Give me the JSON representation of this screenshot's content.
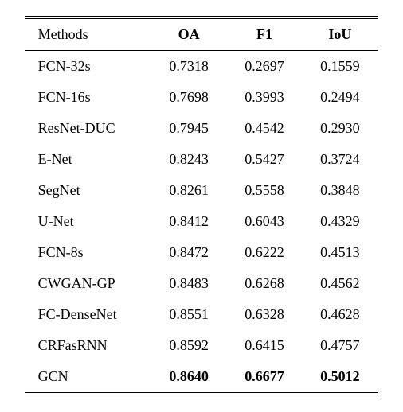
{
  "chart_data": {
    "type": "table",
    "title": "",
    "columns": [
      "Methods",
      "OA",
      "F1",
      "IoU"
    ],
    "rows": [
      {
        "method": "FCN-32s",
        "oa": "0.7318",
        "f1": "0.2697",
        "iou": "0.1559",
        "bold": false
      },
      {
        "method": "FCN-16s",
        "oa": "0.7698",
        "f1": "0.3993",
        "iou": "0.2494",
        "bold": false
      },
      {
        "method": "ResNet-DUC",
        "oa": "0.7945",
        "f1": "0.4542",
        "iou": "0.2930",
        "bold": false
      },
      {
        "method": "E-Net",
        "oa": "0.8243",
        "f1": "0.5427",
        "iou": "0.3724",
        "bold": false
      },
      {
        "method": "SegNet",
        "oa": "0.8261",
        "f1": "0.5558",
        "iou": "0.3848",
        "bold": false
      },
      {
        "method": "U-Net",
        "oa": "0.8412",
        "f1": "0.6043",
        "iou": "0.4329",
        "bold": false
      },
      {
        "method": "FCN-8s",
        "oa": "0.8472",
        "f1": "0.6222",
        "iou": "0.4513",
        "bold": false
      },
      {
        "method": "CWGAN-GP",
        "oa": "0.8483",
        "f1": "0.6268",
        "iou": "0.4562",
        "bold": false
      },
      {
        "method": "FC-DenseNet",
        "oa": "0.8551",
        "f1": "0.6328",
        "iou": "0.4628",
        "bold": false
      },
      {
        "method": "CRFasRNN",
        "oa": "0.8592",
        "f1": "0.6415",
        "iou": "0.4757",
        "bold": false
      },
      {
        "method": "GCN",
        "oa": "0.8640",
        "f1": "0.6677",
        "iou": "0.5012",
        "bold": true
      }
    ]
  }
}
